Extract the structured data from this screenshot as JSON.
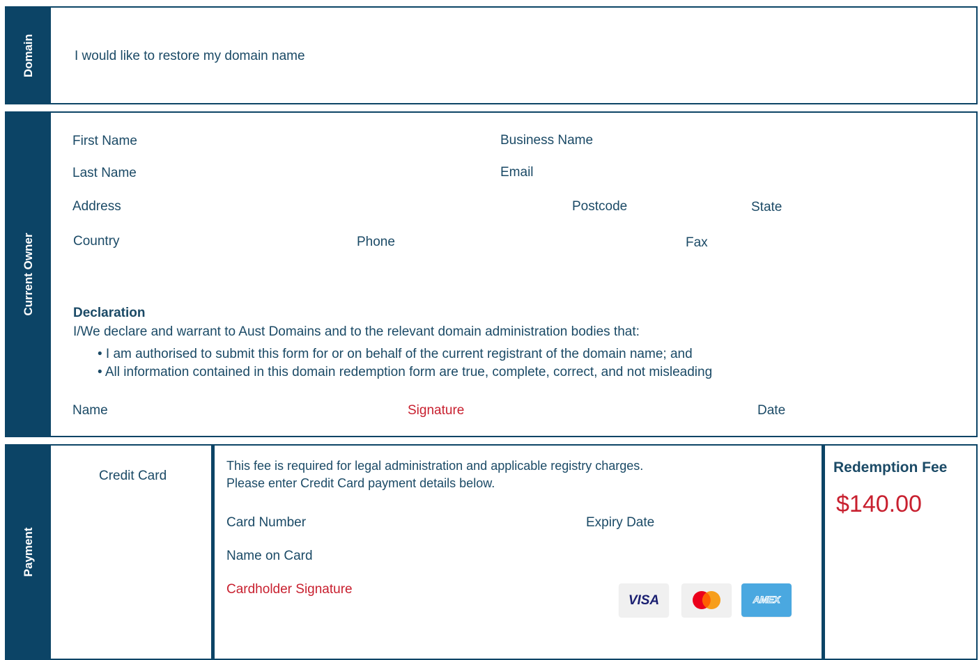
{
  "domain": {
    "tab_label": "Domain",
    "text": "I would like to restore my domain name"
  },
  "owner": {
    "tab_label": "Current Owner",
    "fields": {
      "first_name": "First Name",
      "business_name": "Business Name",
      "last_name": "Last Name",
      "email": "Email",
      "address": "Address",
      "postcode": "Postcode",
      "state": "State",
      "country": "Country",
      "phone": "Phone",
      "fax": "Fax"
    },
    "declaration": {
      "title": "Declaration",
      "intro": "I/We declare and warrant to Aust Domains and to the relevant domain administration bodies that:",
      "bullets": [
        "• I am authorised to submit this form for or on behalf of the current registrant of the domain name; and",
        "• All information contained in this domain redemption form are true, complete, correct, and not misleading"
      ]
    },
    "sign": {
      "name": "Name",
      "signature": "Signature",
      "date": "Date"
    }
  },
  "payment": {
    "tab_label": "Payment",
    "method": "Credit Card",
    "info_line1": "This fee is required for legal administration and applicable registry charges.",
    "info_line2": "Please enter Credit Card payment details below.",
    "card_number": "Card Number",
    "expiry_date": "Expiry Date",
    "name_on_card": "Name on Card",
    "cardholder_signature": "Cardholder Signature",
    "cards": {
      "visa": "VISA",
      "amex": "AMEX"
    },
    "fee_title": "Redemption Fee",
    "fee_amount": "$140.00"
  },
  "colors": {
    "navy": "#0c4466",
    "text": "#1b4a66",
    "accent_red": "#c8202f",
    "visa_blue": "#1a1f71",
    "amex_blue": "#4aa8e0"
  }
}
